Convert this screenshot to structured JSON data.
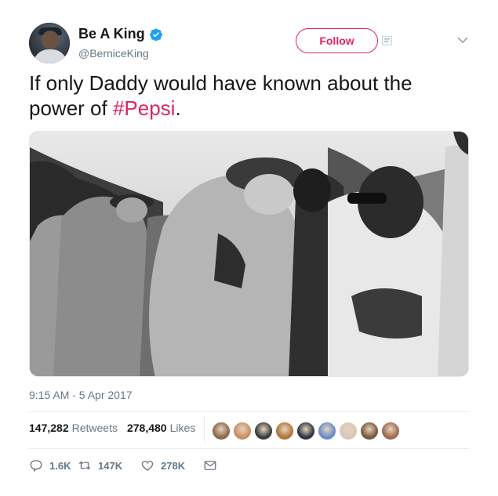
{
  "tweet": {
    "display_name": "Be A King",
    "handle": "@BerniceKing",
    "follow_label": "Follow",
    "text_before": "If only Daddy would have known about the power of ",
    "hashtag": "#Pepsi",
    "text_after": ".",
    "timestamp": "9:15 AM - 5 Apr 2017",
    "retweets_count": "147,282",
    "retweets_label": "Retweets",
    "likes_count": "278,480",
    "likes_label": "Likes",
    "reply_count": "1.6K",
    "retweet_count_short": "147K",
    "like_count_short": "278K"
  },
  "icons": {
    "verified": "verified-badge-icon",
    "follow_add": "add-user-icon",
    "caret": "chevron-down-icon",
    "reply": "reply-icon",
    "retweet": "retweet-icon",
    "like": "heart-icon",
    "dm": "envelope-icon"
  },
  "colors": {
    "accent": "#e0245e",
    "verified": "#1da1f2",
    "muted": "#657786",
    "text": "#14171a"
  },
  "likers": [
    {
      "color": "#8a6a4a"
    },
    {
      "color": "#c89060"
    },
    {
      "color": "#3b3b3b"
    },
    {
      "color": "#b0763a"
    },
    {
      "color": "#2e3440"
    },
    {
      "color": "#6a8cc8"
    },
    {
      "color": "#d8c8b8"
    },
    {
      "color": "#7a5a3a"
    },
    {
      "color": "#a06a50"
    }
  ]
}
